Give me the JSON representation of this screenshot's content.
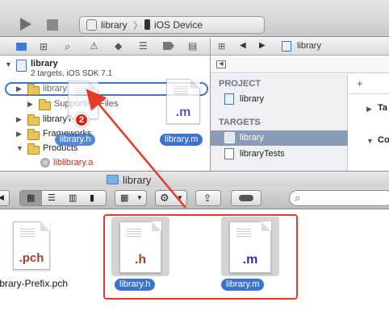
{
  "toolbar": {
    "scheme": "library",
    "destination": "iOS Device"
  },
  "navigator": {
    "project_name": "library",
    "project_subtitle": "2 targets, iOS SDK 7.1",
    "items": [
      {
        "label": "library"
      },
      {
        "label": "Supporting Files"
      },
      {
        "label": "libraryT"
      },
      {
        "label": "Frameworks"
      },
      {
        "label": "Products"
      },
      {
        "label": "liblibrary.a"
      }
    ],
    "drag_badge_count": "2",
    "drag_ghost_h": "library.h",
    "drag_ghost_m": "library.m",
    "drag_ghost_m_ext": ".m"
  },
  "editor": {
    "jump_label": "library",
    "project_section": "PROJECT",
    "project_item": "library",
    "targets_section": "TARGETS",
    "targets": [
      {
        "label": "library"
      },
      {
        "label": "libraryTests"
      }
    ],
    "right_col_a": "Ta",
    "right_col_b": "Co"
  },
  "finder": {
    "title": "library",
    "search_placeholder": "",
    "files": [
      {
        "ext": ".pch",
        "label": "library-Prefix.pch",
        "ext_color": "#b23a2a"
      },
      {
        "ext": ".h",
        "label": "library.h",
        "ext_color": "#b23a2a"
      },
      {
        "ext": ".m",
        "label": "library.m",
        "ext_color": "#3a2aa8"
      }
    ]
  },
  "colors": {
    "selection": "#3b73cf",
    "highlight_box": "#e53a2c",
    "product_missing": "#d0281d"
  }
}
